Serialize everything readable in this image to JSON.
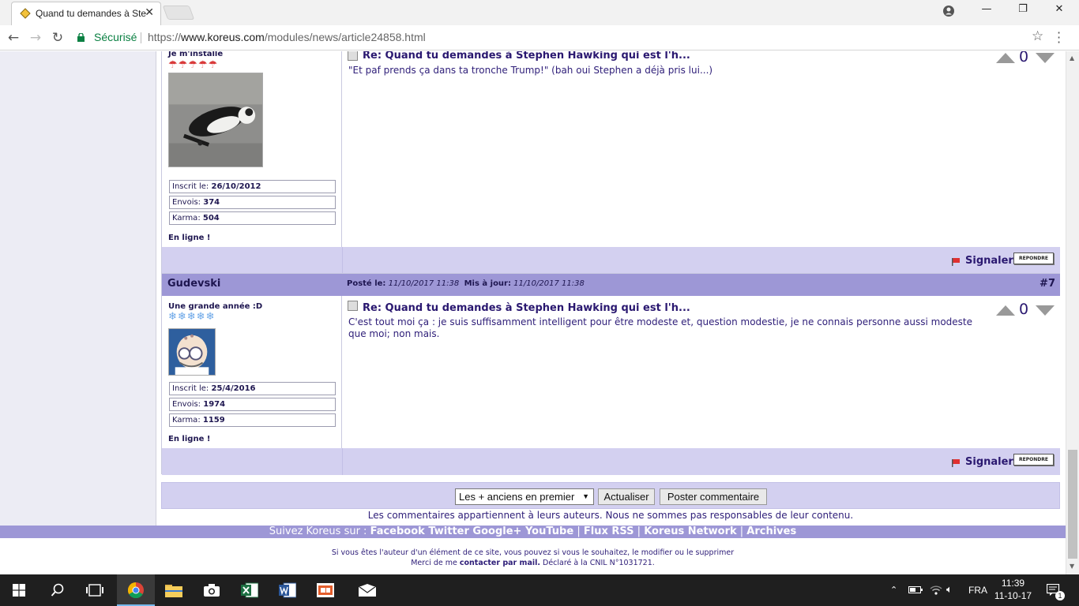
{
  "browser": {
    "tab_title": "Quand tu demandes à Stephen Hawking qui est l'h...",
    "secure_label": "Sécurisé",
    "url_scheme": "https://",
    "url_host": "www.koreus.com",
    "url_path": "/modules/news/article24858.html",
    "close_glyph": "✕",
    "minimize_glyph": "—",
    "maximize_glyph": "❐",
    "window_close_glyph": "✕"
  },
  "comments": [
    {
      "username": "",
      "rank": "Je m'installe",
      "rank_icons": "☂☂☂☂☂",
      "rank_icon_color": "#d93a3a",
      "inscrit_label": "Inscrit le:",
      "inscrit": "26/10/2012",
      "envois_label": "Envois:",
      "envois": "374",
      "karma_label": "Karma:",
      "karma": "504",
      "status": "En ligne !",
      "title": "Re: Quand tu demandes à Stephen Hawking qui est l'h...",
      "body": "\"Et paf prends ça dans ta tronche Trump!\" (bah oui Stephen a déjà pris lui...)",
      "votes": "0",
      "report_label": "Signaler",
      "reply_label": "REPONDRE"
    },
    {
      "username": "Gudevski",
      "posted_label": "Posté le:",
      "posted": "11/10/2017 11:38",
      "updated_label": "Mis à jour:",
      "updated": "11/10/2017 11:38",
      "number": "#7",
      "rank": "Une grande année :D",
      "rank_icons": "❄❄❄❄❄",
      "rank_icon_color": "#6aa6e8",
      "inscrit_label": "Inscrit le:",
      "inscrit": "25/4/2016",
      "envois_label": "Envois:",
      "envois": "1974",
      "karma_label": "Karma:",
      "karma": "1159",
      "status": "En ligne !",
      "title": "Re: Quand tu demandes à Stephen Hawking qui est l'h...",
      "body": "C'est tout moi ça : je suis suffisamment intelligent pour être modeste et, question modestie, je ne connais personne aussi modeste que moi; non mais.",
      "votes": "0",
      "report_label": "Signaler",
      "reply_label": "REPONDRE"
    }
  ],
  "controls": {
    "order_selected": "Les + anciens en premier",
    "refresh_label": "Actualiser",
    "post_label": "Poster commentaire"
  },
  "disclaimer": "Les commentaires appartiennent à leurs auteurs. Nous ne sommes pas responsables de leur contenu.",
  "social": {
    "prefix": "Suivez Koreus sur :",
    "links": "Facebook Twitter Google+ YouTube",
    "sep1": "|",
    "rss": "Flux RSS",
    "sep2": "|",
    "network": "Koreus Network",
    "sep3": "|",
    "archives": "Archives"
  },
  "legal": {
    "line1": "Si vous êtes l'auteur d'un élément de ce site, vous pouvez si vous le souhaitez, le modifier ou le supprimer",
    "line2_prefix": "Merci de me",
    "line2_link": "contacter par mail.",
    "line2_suffix": "Déclaré à la CNIL N°1031721."
  },
  "taskbar": {
    "language": "FRA",
    "time": "11:39",
    "date": "11-10-17",
    "notification_count": "1"
  },
  "colors": {
    "header_bar": "#9d97d6",
    "footer_bar": "#d3d0f0",
    "text_dark": "#1e1650"
  }
}
